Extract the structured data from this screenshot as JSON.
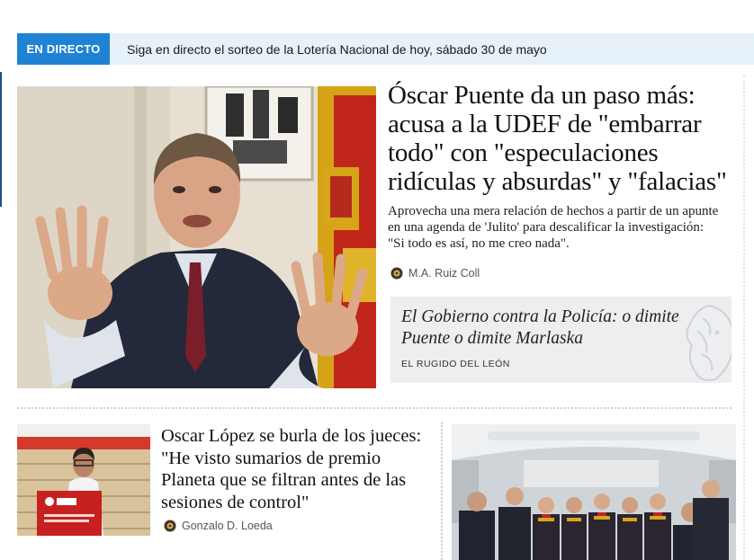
{
  "live": {
    "tag": "EN DIRECTO",
    "text": "Siga en directo el sorteo de la Lotería Nacional de hoy, sábado 30 de mayo"
  },
  "main_story": {
    "title": "Óscar Puente da un paso más: acusa a la UDEF de \"embarrar todo\" con \"especulaciones ridículas y absurdas\" y \"falacias\"",
    "summary": "Aprovecha una mera relación de hechos a partir de un apunte en una agenda de 'Julito' para descalificar la investigación: \"Si todo es así, no me creo nada\".",
    "author": "M.A. Ruiz Coll",
    "image": "politician-gesturing-photo"
  },
  "opinion": {
    "title": "El Gobierno contra la Policía: o dimite Puente o dimite Marlaska",
    "section": "EL RUGIDO DEL LEÓN",
    "icon": "lion-icon"
  },
  "story2": {
    "title": "Oscar López se burla de los jueces: \"He visto sumarios de premio Planeta que se filtran antes de las sesiones de control\"",
    "author": "Gonzalo D. Loeda",
    "image": "speaker-at-podium-photo"
  },
  "story3": {
    "image": "airline-crew-photo"
  },
  "colors": {
    "live_tag_bg": "#1f82d4",
    "live_bar_bg": "#e7f1fa",
    "opinion_bg": "#eceef0"
  }
}
